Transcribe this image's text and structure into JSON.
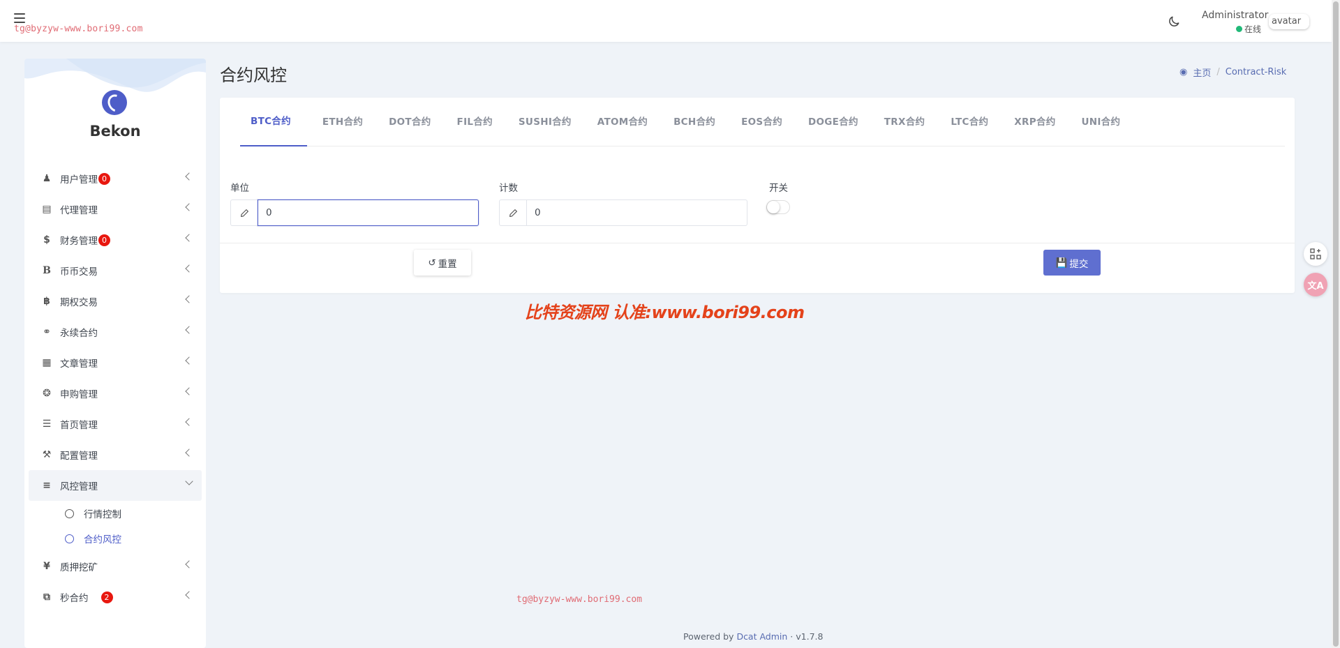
{
  "navbar": {
    "watermark": "tg@byzyw-www.bori99.com",
    "user_name": "Administrator",
    "user_status": "在线",
    "avatar_alt": "avatar"
  },
  "sidebar": {
    "brand": "Bekon",
    "items": [
      {
        "label": "用户管理",
        "icon": "user-icon",
        "badge": "0"
      },
      {
        "label": "代理管理",
        "icon": "id-card-icon"
      },
      {
        "label": "财务管理",
        "icon": "dollar-icon",
        "badge": "0"
      },
      {
        "label": "币币交易",
        "icon": "bold-b-icon"
      },
      {
        "label": "期权交易",
        "icon": "bitcoin-icon"
      },
      {
        "label": "永续合约",
        "icon": "link-icon"
      },
      {
        "label": "文章管理",
        "icon": "newspaper-icon"
      },
      {
        "label": "申购管理",
        "icon": "lifebuoy-icon"
      },
      {
        "label": "首页管理",
        "icon": "list-icon"
      },
      {
        "label": "配置管理",
        "icon": "wrench-icon"
      },
      {
        "label": "风控管理",
        "icon": "indent-icon"
      },
      {
        "label": "质押挖矿",
        "icon": "yen-icon"
      },
      {
        "label": "秒合约",
        "icon": "copy-icon",
        "badge": "2"
      }
    ],
    "submenu": [
      {
        "label": "行情控制"
      },
      {
        "label": "合约风控"
      }
    ]
  },
  "page": {
    "title": "合约风控",
    "breadcrumb_home": "主页",
    "breadcrumb_current": "Contract-Risk"
  },
  "tabs": [
    "BTC合约",
    "ETH合约",
    "DOT合约",
    "FIL合约",
    "SUSHI合约",
    "ATOM合约",
    "BCH合约",
    "EOS合约",
    "DOGE合约",
    "TRX合约",
    "LTC合约",
    "XRP合约",
    "UNI合约"
  ],
  "form": {
    "unit_label": "单位",
    "unit_value": "0",
    "count_label": "计数",
    "count_value": "0",
    "switch_label": "开关",
    "switch_on": false,
    "reset_label": "重置",
    "submit_label": "提交"
  },
  "promo_text": "比特资源网 认准:www.bori99.com",
  "watermark_mid": "tg@byzyw-www.bori99.com",
  "footer": {
    "powered_by": "Powered by",
    "link": "Dcat Admin",
    "version": "v1.7.8"
  },
  "colors": {
    "primary": "#4e5dc8",
    "badge": "#e8170f",
    "online": "#21b978",
    "promo": "#e4421a"
  }
}
